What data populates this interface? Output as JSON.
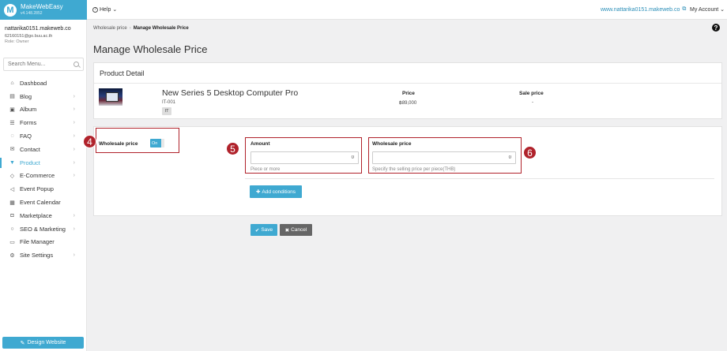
{
  "brand": {
    "name": "MakeWebEasy",
    "version": "v4.148.2852"
  },
  "topbar": {
    "help": "Help",
    "site_url": "www.nattarika0151.makeweb.co",
    "account": "My Account"
  },
  "user": {
    "name": "nattarika0151.makeweb.co",
    "email": "62160151@go.buu.ac.th",
    "role": "Role: Owner"
  },
  "sidebar": {
    "search_placeholder": "Search Menu...",
    "items": [
      {
        "label": "Dashboad",
        "icon": "home-icon",
        "chevron": false
      },
      {
        "label": "Blog",
        "icon": "document-icon",
        "chevron": true
      },
      {
        "label": "Album",
        "icon": "image-icon",
        "chevron": true
      },
      {
        "label": "Forms",
        "icon": "list-icon",
        "chevron": true
      },
      {
        "label": "FAQ",
        "icon": "chat-icon",
        "chevron": true
      },
      {
        "label": "Contact",
        "icon": "envelope-icon",
        "chevron": true
      },
      {
        "label": "Product",
        "icon": "cart-icon",
        "chevron": true,
        "active": true
      },
      {
        "label": "E-Commerce",
        "icon": "tag-icon",
        "chevron": true
      },
      {
        "label": "Event Popup",
        "icon": "megaphone-icon",
        "chevron": false
      },
      {
        "label": "Event Calendar",
        "icon": "calendar-icon",
        "chevron": false
      },
      {
        "label": "Marketplace",
        "icon": "bag-icon",
        "chevron": true
      },
      {
        "label": "SEO & Marketing",
        "icon": "search-icon",
        "chevron": true
      },
      {
        "label": "File Manager",
        "icon": "folder-icon",
        "chevron": false
      },
      {
        "label": "Site Settings",
        "icon": "gear-icon",
        "chevron": true
      }
    ],
    "design_button": "Design Website"
  },
  "breadcrumb": {
    "parent": "Wholesale price",
    "current": "Manage Wholesale Price"
  },
  "page_title": "Manage Wholesale Price",
  "product_detail": {
    "heading": "Product Detail",
    "name": "New Series 5 Desktop Computer Pro",
    "sku": "IT-001",
    "tag": "IT",
    "price_label": "Price",
    "price_value": "฿89,000",
    "sale_label": "Sale price",
    "sale_value": "-"
  },
  "wholesale": {
    "label": "Wholesale price",
    "toggle": "On",
    "amount_label": "Amount",
    "amount_value": "0",
    "amount_help": "Piece or more",
    "price_label": "Wholesale price",
    "price_value": "0",
    "price_help": "Specify the selling price per piece(THB)",
    "add_conditions": "Add conditions"
  },
  "actions": {
    "save": "Save",
    "cancel": "Cancel"
  },
  "annotations": {
    "badge4": "4",
    "badge5": "5",
    "badge6": "6",
    "color": "#b0222b"
  },
  "colors": {
    "accent": "#3fa9d1",
    "cancel": "#666666"
  }
}
